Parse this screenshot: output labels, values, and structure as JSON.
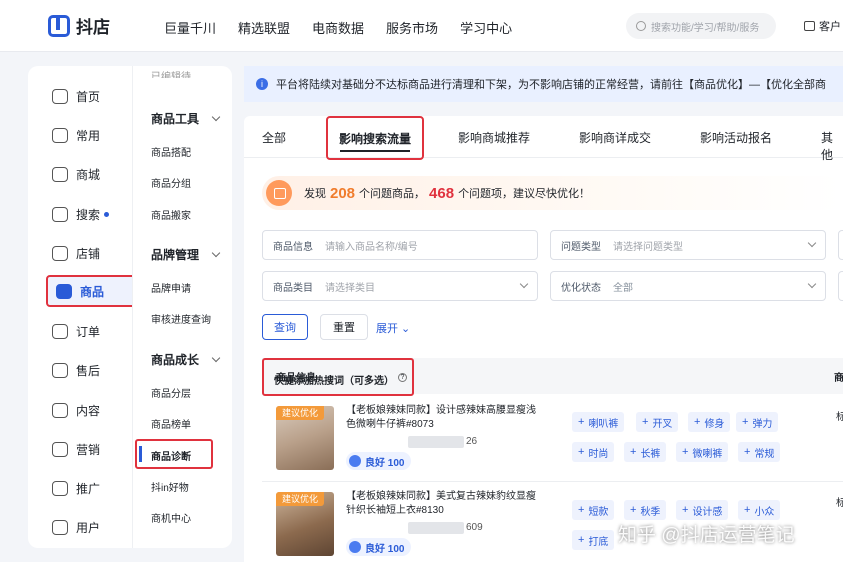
{
  "topbar": {
    "logo_text": "抖店",
    "nav": [
      "巨量千川",
      "精选联盟",
      "电商数据",
      "服务市场",
      "学习中心"
    ],
    "search_placeholder": "搜索功能/学习/帮助/服务",
    "customer_label": "客户"
  },
  "sidebar": {
    "items": [
      {
        "label": "首页",
        "icon": "home-icon"
      },
      {
        "label": "常用",
        "icon": "folder-icon"
      },
      {
        "label": "商城",
        "icon": "store-icon"
      },
      {
        "label": "搜索",
        "icon": "search-icon"
      },
      {
        "label": "店铺",
        "icon": "shop-icon"
      },
      {
        "label": "商品",
        "icon": "product-icon"
      },
      {
        "label": "订单",
        "icon": "order-icon"
      },
      {
        "label": "售后",
        "icon": "aftersale-icon"
      },
      {
        "label": "内容",
        "icon": "content-icon"
      },
      {
        "label": "营销",
        "icon": "marketing-icon"
      },
      {
        "label": "推广",
        "icon": "promote-icon"
      },
      {
        "label": "用户",
        "icon": "user-icon"
      }
    ],
    "active": "商品"
  },
  "subnav": {
    "cut_top": "已编辑待",
    "groups": [
      {
        "title": "商品工具",
        "items": [
          "商品搭配",
          "商品分组",
          "商品搬家"
        ]
      },
      {
        "title": "品牌管理",
        "items": [
          "品牌申请",
          "审核进度查询"
        ]
      },
      {
        "title": "商品成长",
        "items": [
          "商品分层",
          "商品榜单",
          "商品诊断",
          "抖in好物",
          "商机中心"
        ]
      }
    ],
    "active": "商品诊断"
  },
  "notice": {
    "text": "平台将陆续对基础分不达标商品进行清理和下架，为不影响店铺的正常经营，请前往【商品优化】—【优化全部商"
  },
  "tabs": [
    "全部",
    "影响搜索流量",
    "影响商城推荐",
    "影响商详成交",
    "影响活动报名",
    "其他"
  ],
  "active_tab": "影响搜索流量",
  "banner": {
    "prefix": "发现",
    "count1": "208",
    "mid": "个问题商品，",
    "count2": "468",
    "suffix": "个问题项，建议尽快优化！"
  },
  "filters": {
    "product_info_label": "商品信息",
    "product_info_placeholder": "请输入商品名称/编号",
    "issue_type_label": "问题类型",
    "issue_type_placeholder": "请选择问题类型",
    "category_label": "商品类目",
    "category_placeholder": "请选择类目",
    "status_label": "优化状态",
    "status_value": "全部",
    "query_button": "查询",
    "reset_button": "重置",
    "expand": "展开"
  },
  "table": {
    "col_product": "商品信息",
    "col_hotwords": "快捷添加热搜词（可多选）",
    "col_cut": "商",
    "rows": [
      {
        "tag": "建议优化",
        "title": "【老板娘辣妹同款】设计感辣妹高腰显瘦浅色微喇牛仔裤#8073",
        "id_suffix": "26",
        "score": "良好 100",
        "keywords": [
          "喇叭裤",
          "开叉",
          "修身",
          "弹力",
          "时尚",
          "长裤",
          "微喇裤",
          "常规"
        ],
        "right_cut": "标"
      },
      {
        "tag": "建议优化",
        "title": "【老板娘辣妹同款】美式复古辣妹豹纹显瘦针织长袖短上衣#8130",
        "id_suffix": "609",
        "score": "良好 100",
        "keywords": [
          "短款",
          "秋季",
          "设计感",
          "小众",
          "打底"
        ],
        "right_cut": "标"
      }
    ]
  },
  "watermark": "知乎 @抖店运营笔记"
}
